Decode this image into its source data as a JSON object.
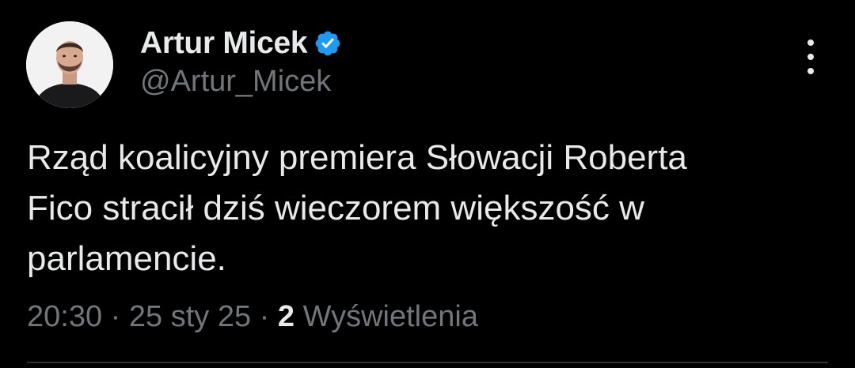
{
  "author": {
    "display_name": "Artur Micek",
    "handle": "@Artur_Micek",
    "verified": true,
    "verified_color": "#1d9bf0"
  },
  "tweet": {
    "text": "Rząd koalicyjny premiera Słowacji Roberta\nFico stracił dziś wieczorem większość w\nparlamencie.",
    "time": "20:30",
    "separator": "·",
    "date": "25 sty 25",
    "views_count": "2",
    "views_label": "Wyświetlenia"
  },
  "icons": {
    "verified": "verified-badge-icon",
    "more": "more-options-icon"
  },
  "colors": {
    "background": "#000000",
    "primary_text": "#e7e9ea",
    "secondary_text": "#71767b",
    "divider": "#2f3336"
  }
}
